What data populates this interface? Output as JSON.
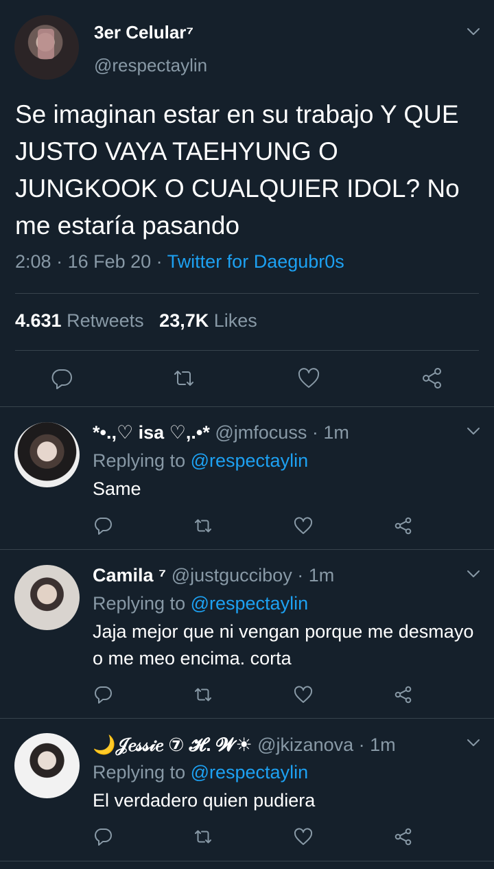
{
  "main_tweet": {
    "name": "3er Celular⁷",
    "handle": "@respectaylin",
    "text": "Se imaginan estar en su trabajo Y QUE JUSTO VAYA TAEHYUNG O JUNGKOOK O CUALQUIER IDOL? No me estaría pasando",
    "time": "2:08",
    "sep": " · ",
    "date": "16 Feb 20",
    "source": "Twitter for Daegubr0s",
    "retweets_count": "4.631",
    "retweets_label": "Retweets",
    "likes_count": "23,7K",
    "likes_label": "Likes"
  },
  "replies": [
    {
      "name": "*•.,♡ isa ♡,.•*",
      "handle": "@jmfocuss",
      "time": "1m",
      "replying_prefix": "Replying to",
      "replying_to": "@respectaylin",
      "text": "Same"
    },
    {
      "name": "Camila ⁷",
      "handle": "@justgucciboy",
      "time": "1m",
      "replying_prefix": "Replying to",
      "replying_to": "@respectaylin",
      "text": "Jaja mejor que ni vengan porque me desmayo o me meo encima. corta"
    },
    {
      "name": "🌙𝒥𝑒𝓈𝓈𝒾𝑒 ⑦ 𝓗. 𝓦☀",
      "handle": "@jkizanova",
      "time": "1m",
      "replying_prefix": "Replying to",
      "replying_to": "@respectaylin",
      "text": "El verdadero quien pudiera"
    }
  ],
  "icons": {
    "reply": "reply-icon",
    "retweet": "retweet-icon",
    "like": "heart-icon",
    "share": "share-icon",
    "menu": "chevron-down-icon"
  },
  "colors": {
    "background": "#15202b",
    "text": "#ffffff",
    "muted": "#8899a6",
    "link": "#1da1f2",
    "divider": "#38444d"
  }
}
